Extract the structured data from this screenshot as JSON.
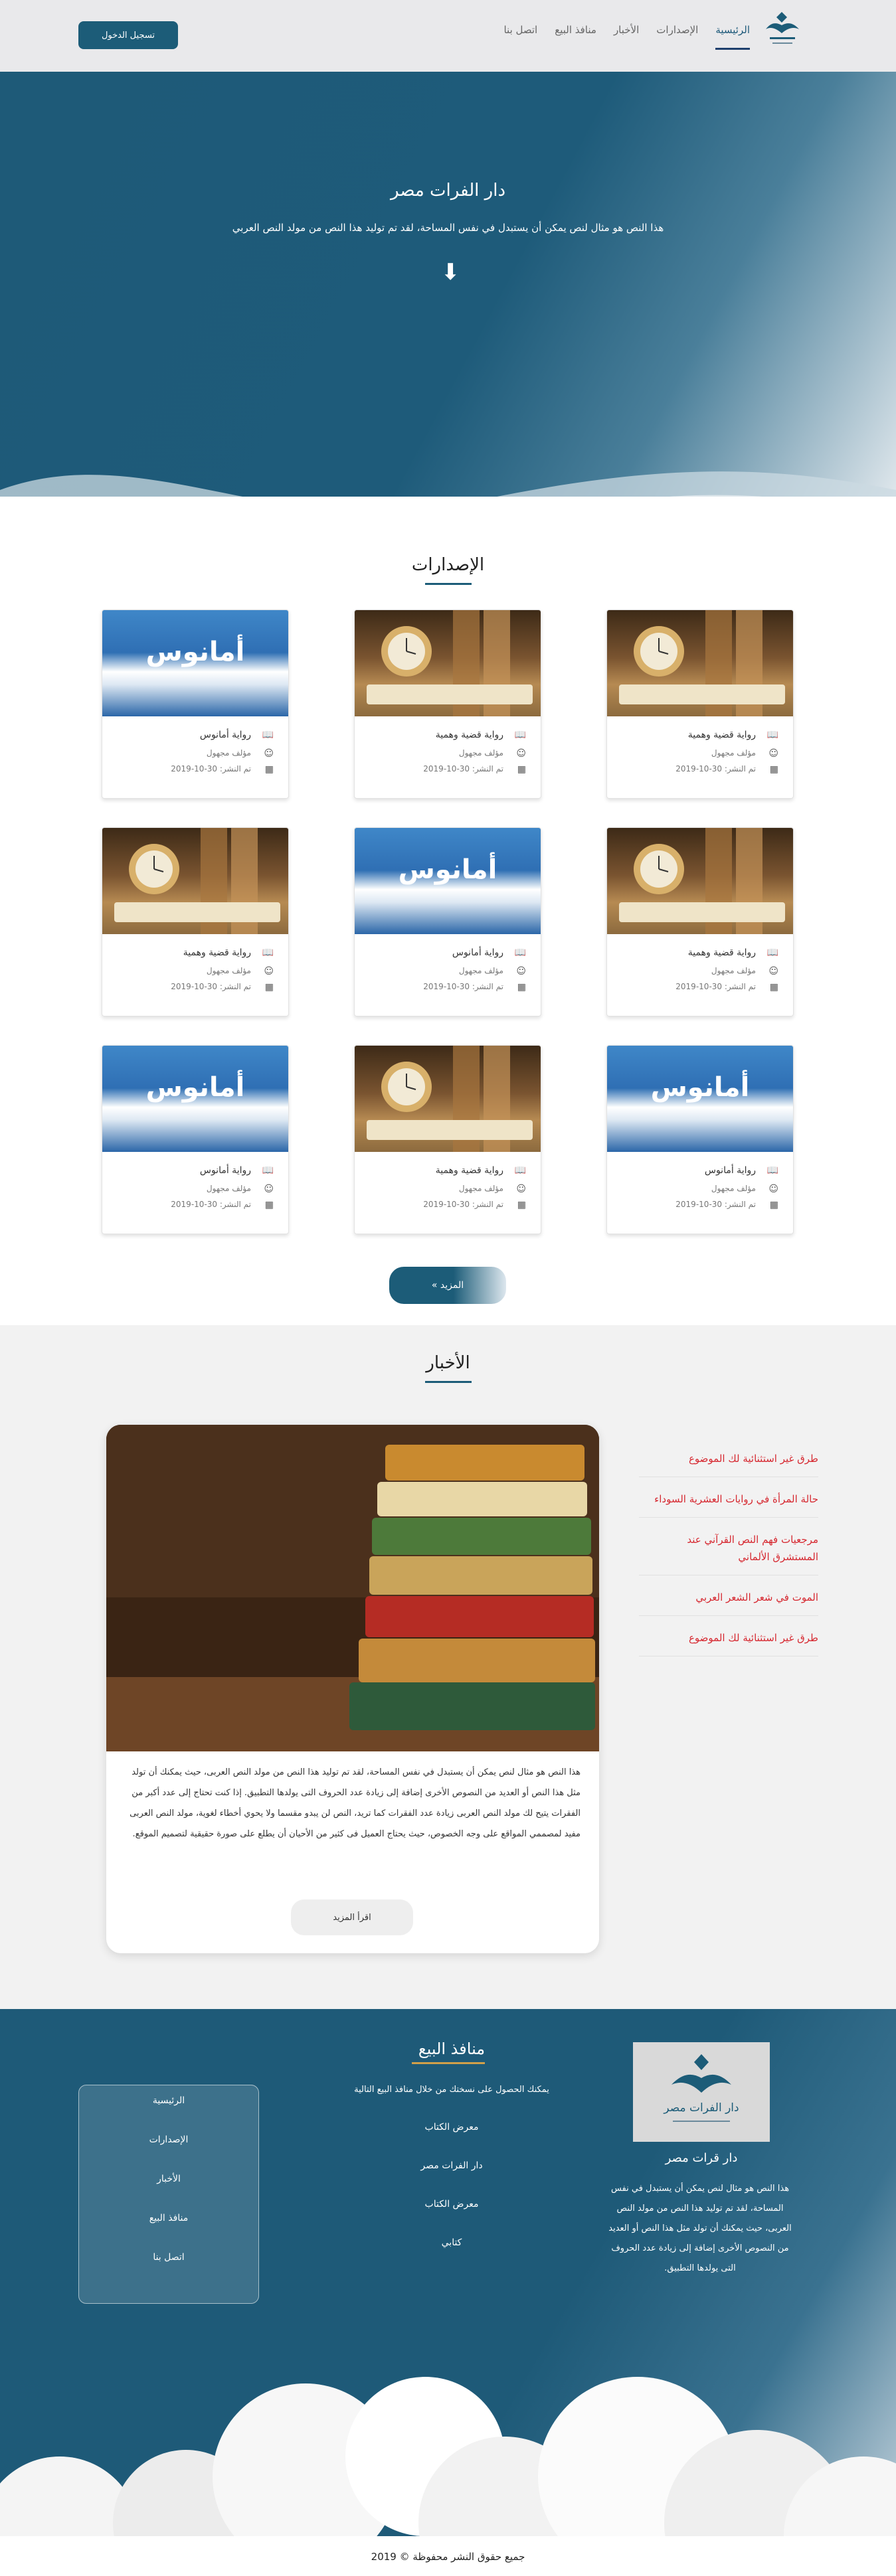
{
  "nav": {
    "logo_text": "دار الفرات مصر",
    "links": [
      "الرئيسية",
      "الإصدارات",
      "الأخبار",
      "منافذ البيع",
      "اتصل بنا"
    ],
    "login_label": "تسجيل الدخول"
  },
  "hero": {
    "title": "دار الفرات مصر",
    "text": "هذا النص هو مثال لنص يمكن أن يستبدل في نفس المساحة، لقد تم توليد هذا النص من مولد النص العربي",
    "arrow_icon": "arrow-down-icon"
  },
  "releases": {
    "title": "الإصدارات",
    "cards": [
      {
        "title": "رواية قضية وهمية",
        "author": "مؤلف مجهول",
        "date": "تم النشر: 30-10-2019",
        "cover": "clock"
      },
      {
        "title": "رواية قضية وهمية",
        "author": "مؤلف مجهول",
        "date": "تم النشر: 30-10-2019",
        "cover": "clock"
      },
      {
        "title": "رواية أمانوس",
        "author": "مؤلف مجهول",
        "date": "تم النشر: 30-10-2019",
        "cover": "mount"
      },
      {
        "title": "رواية قضية وهمية",
        "author": "مؤلف مجهول",
        "date": "تم النشر: 30-10-2019",
        "cover": "clock"
      },
      {
        "title": "رواية أمانوس",
        "author": "مؤلف مجهول",
        "date": "تم النشر: 30-10-2019",
        "cover": "mount"
      },
      {
        "title": "رواية قضية وهمية",
        "author": "مؤلف مجهول",
        "date": "تم النشر: 30-10-2019",
        "cover": "clock"
      },
      {
        "title": "رواية أمانوس",
        "author": "مؤلف مجهول",
        "date": "تم النشر: 30-10-2019",
        "cover": "mount"
      },
      {
        "title": "رواية قضية وهمية",
        "author": "مؤلف مجهول",
        "date": "تم النشر: 30-10-2019",
        "cover": "clock"
      },
      {
        "title": "رواية أمانوس",
        "author": "مؤلف مجهول",
        "date": "تم النشر: 30-10-2019",
        "cover": "mount"
      }
    ],
    "cover_caption": "أمانوس",
    "more_label": "المزيد »"
  },
  "news": {
    "title": "الأخبار",
    "text": "هذا النص هو مثال لنص يمكن أن يستبدل في نفس المساحة، لقد تم توليد هذا النص من مولد النص العربى، حيث يمكنك أن تولد مثل هذا النص أو العديد من النصوص الأخرى إضافة إلى زيادة عدد الحروف التى يولدها التطبيق. إذا كنت تحتاج إلى عدد أكبر من الفقرات يتيح لك مولد النص العربى زيادة عدد الفقرات كما تريد، النص لن يبدو مقسما ولا يحوي أخطاء لغوية، مولد النص العربى مفيد لمصممي المواقع على وجه الخصوص، حيث يحتاج العميل فى كثير من الأحيان أن يطلع على صورة حقيقية لتصميم الموقع.",
    "read_more_label": "اقرأ المزيد",
    "links": [
      "طرق غير استثنائية لك الموضوع",
      "حالة المرأة في روايات العشرية السوداء",
      "مرجعيات فهم النص القرآني عند المستشرق الألماني",
      "الموت في شعر الشعر العربي",
      "طرق غير استثنائية لك الموضوع"
    ]
  },
  "footer": {
    "brand": "دار قرات مصر",
    "logo_text": "دار الفرات مصر",
    "about": "هذا النص هو مثال لنص يمكن أن يستبدل في نفس المساحة، لقد تم توليد هذا النص من مولد النص العربى، حيث يمكنك أن تولد مثل هذا النص أو العديد من النصوص الأخرى إضافة إلى زيادة عدد الحروف التى يولدها التطبيق.",
    "sales_title": "منافذ البيع",
    "sales_intro": "يمكنك الحصول على نسختك من خلال منافذ البيع التالية",
    "sales_list": [
      "معرض الكتاب",
      "دار الفرات مصر",
      "معرض الكتاب",
      "كتابي"
    ],
    "nav_links": [
      "الرئيسية",
      "الإصدارات",
      "الأخبار",
      "منافذ البيع",
      "اتصل بنا"
    ],
    "copyright": "جميع حقوق النشر محفوظة © 2019"
  },
  "colors": {
    "primary": "#1c5c78",
    "accent_red": "#d62830",
    "nav_bg": "#e9e9eb"
  }
}
